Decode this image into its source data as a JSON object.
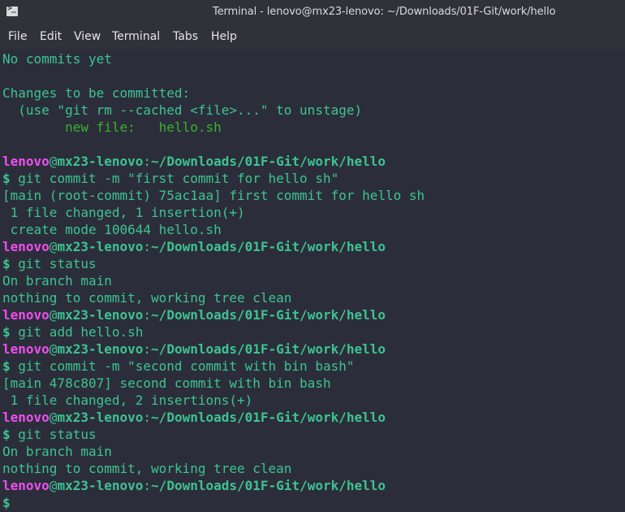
{
  "window": {
    "title": "Terminal - lenovo@mx23-lenovo: ~/Downloads/01F-Git/work/hello",
    "icon": "terminal-icon"
  },
  "menu": {
    "file": "File",
    "edit": "Edit",
    "view": "View",
    "terminal": "Terminal",
    "tabs": "Tabs",
    "help": "Help"
  },
  "prompt": {
    "user": "lenovo",
    "at": "@",
    "host": "mx23-lenovo",
    "colon": ":",
    "path": "~/Downloads/01F-Git/work/hello",
    "dollar": "$"
  },
  "output": {
    "l0": "No commits yet",
    "l2": "Changes to be committed:",
    "l3": "  (use \"git rm --cached <file>...\" to unstage)",
    "l4": "        new file:   hello.sh",
    "l8": "[main (root-commit) 75ac1aa] first commit for hello sh",
    "l9": " 1 file changed, 1 insertion(+)",
    "l10": " create mode 100644 hello.sh",
    "l13": "On branch main",
    "l14": "nothing to commit, working tree clean",
    "l19": "[main 478c807] second commit with bin bash",
    "l20": " 1 file changed, 2 insertions(+)",
    "l23": "On branch main",
    "l24": "nothing to commit, working tree clean"
  },
  "commands": {
    "c7": " git commit -m \"first commit for hello sh\"",
    "c12": " git status",
    "c16": " git add hello.sh",
    "c18": " git commit -m \"second commit with bin bash\"",
    "c22": " git status",
    "c26": ""
  },
  "colors": {
    "background": "#2b2e3a",
    "chrome": "#2f3238",
    "text_green": "#3ec391",
    "new_file_green": "#3bb12c",
    "user_magenta": "#f04df0"
  }
}
